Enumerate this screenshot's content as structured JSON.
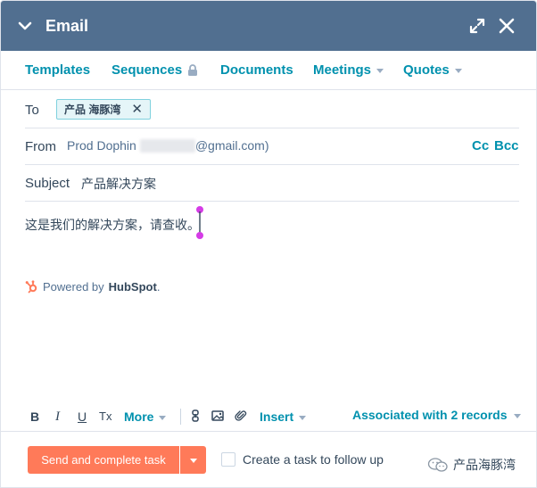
{
  "header": {
    "title": "Email"
  },
  "tabs": [
    {
      "label": "Templates"
    },
    {
      "label": "Sequences"
    },
    {
      "label": "Documents"
    },
    {
      "label": "Meetings"
    },
    {
      "label": "Quotes"
    }
  ],
  "to": {
    "label": "To",
    "recipient": "产品 海豚湾"
  },
  "from": {
    "label": "From",
    "name": "Prod Dophin",
    "email_suffix": "@gmail.com)",
    "cc": "Cc",
    "bcc": "Bcc"
  },
  "subject": {
    "label": "Subject",
    "value": "产品解决方案"
  },
  "body": {
    "text": "这是我们的解决方案，请查收。"
  },
  "powered": {
    "prefix": "Powered by",
    "brand": "HubSpot",
    "suffix": "."
  },
  "toolbar": {
    "bold": "B",
    "italic": "I",
    "underline": "U",
    "clear_format": "Tx",
    "more": "More",
    "insert": "Insert",
    "associated": "Associated with 2 records"
  },
  "footer": {
    "send_label": "Send and complete task",
    "followup_label": "Create a task to follow up",
    "followup_checked": false,
    "watermark": "产品海豚湾"
  },
  "colors": {
    "header": "#516f90",
    "accent": "#0091ae",
    "primary_button": "#ff7a59",
    "hubspot_orange": "#ff7a59"
  }
}
